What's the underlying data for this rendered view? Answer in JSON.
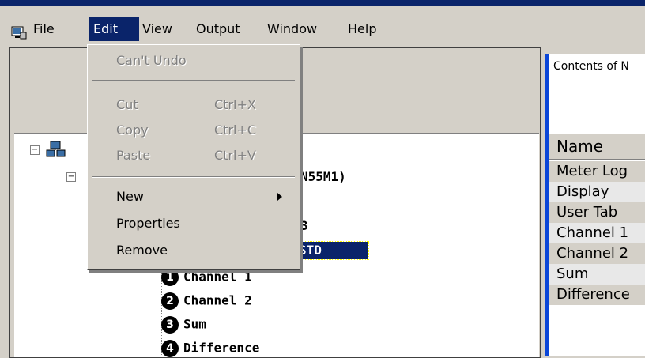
{
  "menubar": {
    "items": [
      "File",
      "Edit",
      "View",
      "Output",
      "Window",
      "Help"
    ],
    "active_index": 1
  },
  "edit_menu": {
    "cant_undo": "Can't Undo",
    "cut": {
      "label": "Cut",
      "shortcut": "Ctrl+X"
    },
    "copy": {
      "label": "Copy",
      "shortcut": "Ctrl+C"
    },
    "paste": {
      "label": "Paste",
      "shortcut": "Ctrl+V"
    },
    "new": "New",
    "properties": "Properties",
    "remove": "Remove"
  },
  "tree": {
    "meter_partial": "N55M1)",
    "item3_partial": "3",
    "selected_partial": "STD",
    "channels": [
      {
        "num": "1",
        "label": "Channel 1"
      },
      {
        "num": "2",
        "label": "Channel 2"
      },
      {
        "num": "3",
        "label": "Sum"
      },
      {
        "num": "4",
        "label": "Difference"
      }
    ]
  },
  "right_pane": {
    "title": "Contents of N",
    "column_header": "Name",
    "rows": [
      "Meter Log",
      "Display",
      "User Tab",
      "Channel 1",
      "Channel 2",
      "Sum",
      "Difference"
    ]
  },
  "colors": {
    "selection": "#0a246a",
    "splitter": "#0a46d8",
    "face": "#d4d0c8"
  }
}
